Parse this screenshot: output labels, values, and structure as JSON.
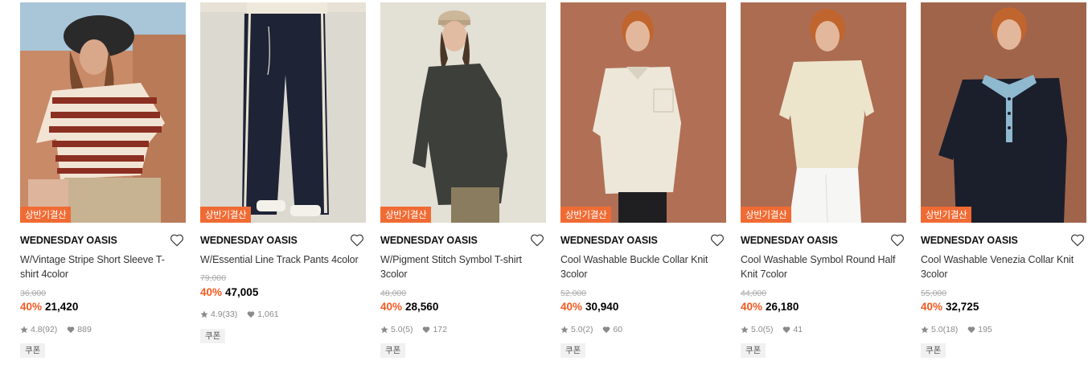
{
  "badge_label": "상반기결산",
  "coupon_label": "쿠폰",
  "colors": {
    "accent": "#f05a22",
    "badge_bg": "#f06b34"
  },
  "icons": {
    "wishlist": "heart-outline-icon",
    "rating": "star-icon",
    "likes": "heart-filled-icon"
  },
  "products": [
    {
      "brand": "WEDNESDAY OASIS",
      "name": "W/Vintage Stripe Short Sleeve T-shirt 4color",
      "original_price": "36,000",
      "discount": "40%",
      "sale_price": "21,420",
      "rating": "4.8",
      "reviews": "(92)",
      "likes": "889"
    },
    {
      "brand": "WEDNESDAY OASIS",
      "name": "W/Essential Line Track Pants 4color",
      "original_price": "79,000",
      "discount": "40%",
      "sale_price": "47,005",
      "rating": "4.9",
      "reviews": "(33)",
      "likes": "1,061"
    },
    {
      "brand": "WEDNESDAY OASIS",
      "name": "W/Pigment Stitch Symbol T-shirt 3color",
      "original_price": "48,000",
      "discount": "40%",
      "sale_price": "28,560",
      "rating": "5.0",
      "reviews": "(5)",
      "likes": "172"
    },
    {
      "brand": "WEDNESDAY OASIS",
      "name": "Cool Washable Buckle Collar Knit 3color",
      "original_price": "52,000",
      "discount": "40%",
      "sale_price": "30,940",
      "rating": "5.0",
      "reviews": "(2)",
      "likes": "60"
    },
    {
      "brand": "WEDNESDAY OASIS",
      "name": "Cool Washable Symbol Round Half Knit 7color",
      "original_price": "44,000",
      "discount": "40%",
      "sale_price": "26,180",
      "rating": "5.0",
      "reviews": "(5)",
      "likes": "41"
    },
    {
      "brand": "WEDNESDAY OASIS",
      "name": "Cool Washable Venezia Collar Knit 3color",
      "original_price": "55,000",
      "discount": "40%",
      "sale_price": "32,725",
      "rating": "5.0",
      "reviews": "(18)",
      "likes": "195"
    }
  ]
}
